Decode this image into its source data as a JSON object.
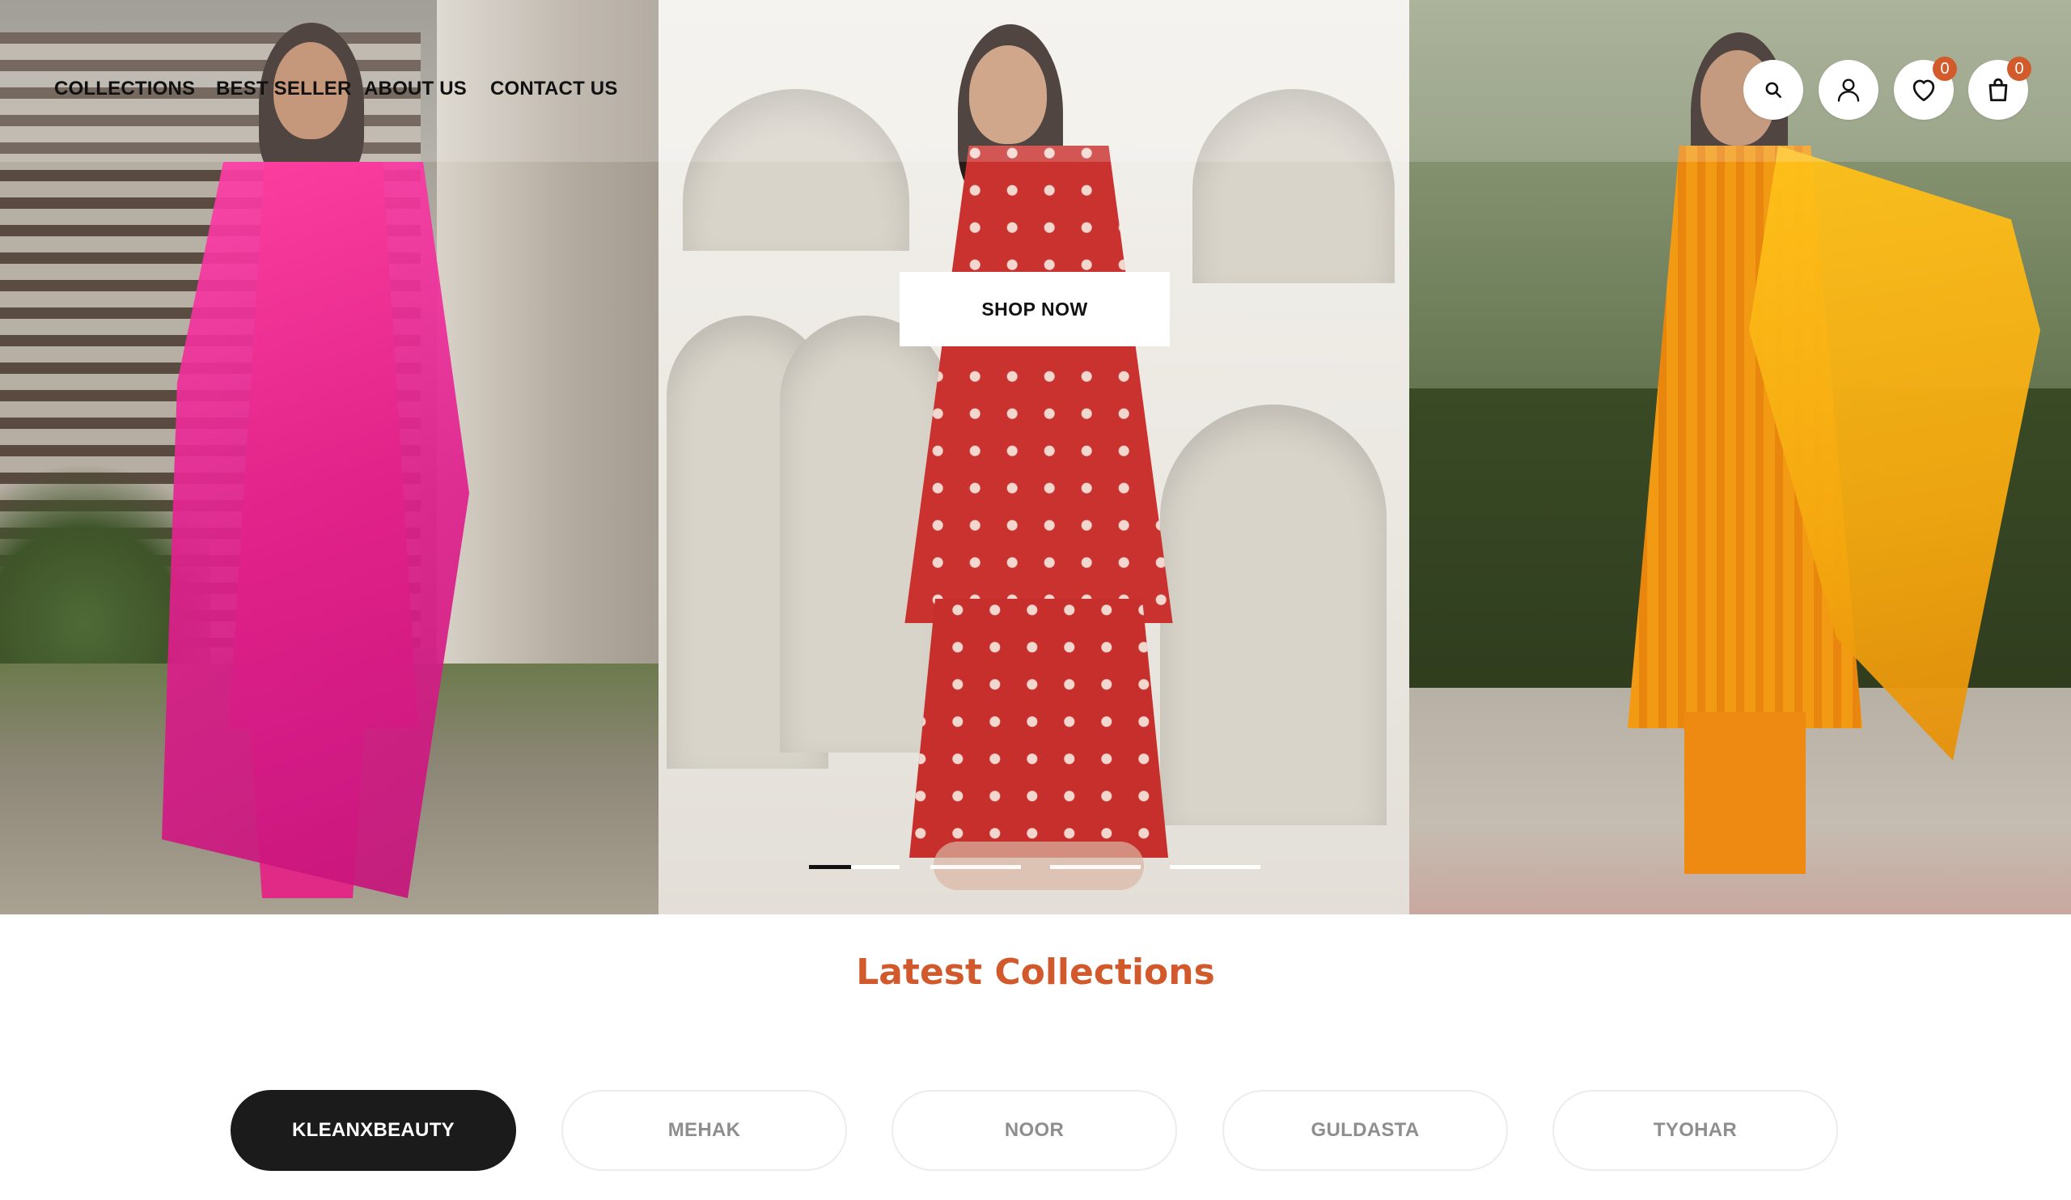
{
  "nav": {
    "items": [
      {
        "label": "COLLECTIONS"
      },
      {
        "label": "BEST SELLER"
      },
      {
        "label": "ABOUT US"
      },
      {
        "label": "CONTACT US"
      }
    ]
  },
  "header_icons": {
    "search": "search-icon",
    "account": "user-icon",
    "wishlist": {
      "icon": "heart-icon",
      "count": "0"
    },
    "cart": {
      "icon": "shopping-bag-icon",
      "count": "0"
    }
  },
  "hero": {
    "cta_label": "SHOP NOW",
    "slides_total": 4,
    "active_slide": 1,
    "slide_progress": 0.46
  },
  "section": {
    "title": "Latest Collections"
  },
  "collections": [
    {
      "label": "KLEANXBEAUTY",
      "active": true
    },
    {
      "label": "MEHAK",
      "active": false
    },
    {
      "label": "NOOR",
      "active": false
    },
    {
      "label": "GULDASTA",
      "active": false
    },
    {
      "label": "TYOHAR",
      "active": false
    }
  ],
  "colors": {
    "accent": "#d1592c",
    "badge": "#d35a2a",
    "chip_active": "#1b1b1b",
    "chip_inactive_text": "#8e8e8e"
  }
}
